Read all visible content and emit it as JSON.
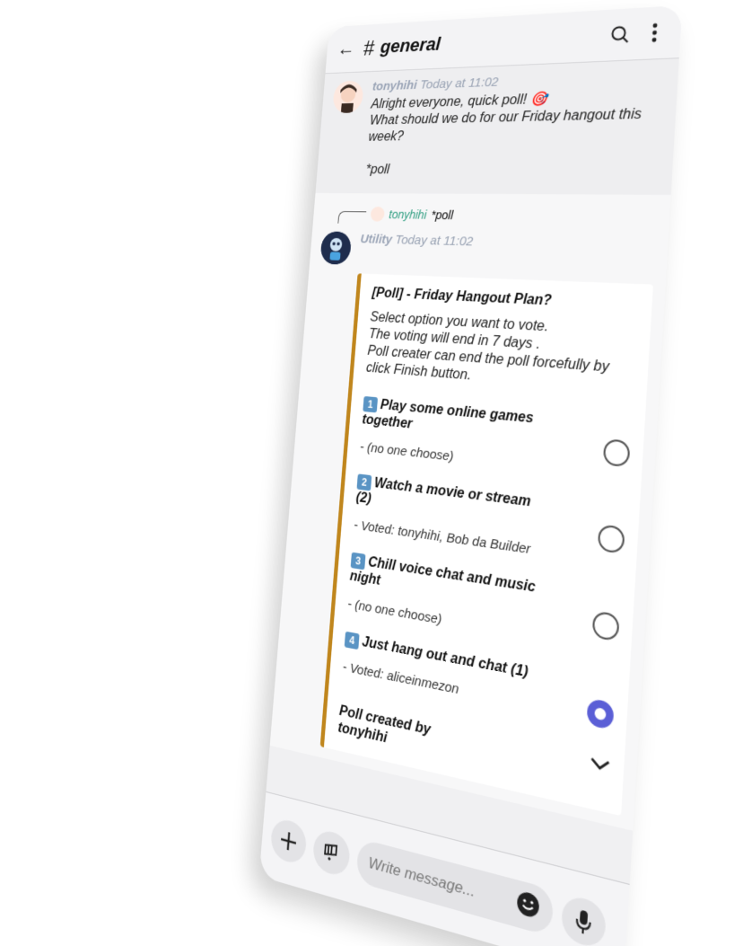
{
  "header": {
    "channel_title": "general",
    "hash": "#"
  },
  "message1": {
    "author": "tonyhihi",
    "timestamp": "Today at 11:02",
    "lines": [
      "Alright everyone, quick poll! 🎯",
      "What should we do for our Friday hangout this week?",
      "",
      "*poll"
    ]
  },
  "reply_ref": {
    "author": "tonyhihi",
    "text": "*poll"
  },
  "message2": {
    "author": "Utility",
    "timestamp": "Today at 11:02"
  },
  "poll": {
    "title": "[Poll] - Friday Hangout Plan?",
    "description_lines": [
      "Select option you want to vote.",
      "The voting will end in 7 days .",
      "Poll creater can end the poll forcefully by click Finish button."
    ],
    "options": [
      {
        "num": "1",
        "label": "Play some online games together",
        "votes": "- (no one choose)",
        "selected": false
      },
      {
        "num": "2",
        "label": "Watch a movie or stream (2)",
        "votes": "- Voted:  tonyhihi,  Bob da Builder",
        "selected": false
      },
      {
        "num": "3",
        "label": "Chill voice chat and music night",
        "votes": "- (no one choose)",
        "selected": false
      },
      {
        "num": "4",
        "label": "Just hang out and chat (1)",
        "votes": "- Voted:  aliceinmezon",
        "selected": true
      }
    ],
    "created_by_label": "Poll created by tonyhihi"
  },
  "composer": {
    "placeholder": "Write message..."
  },
  "colors": {
    "accent": "#5b5fd6",
    "embed_border": "#c0861d",
    "reply_name": "#2e9e80",
    "keycap": "#5a94c4"
  }
}
